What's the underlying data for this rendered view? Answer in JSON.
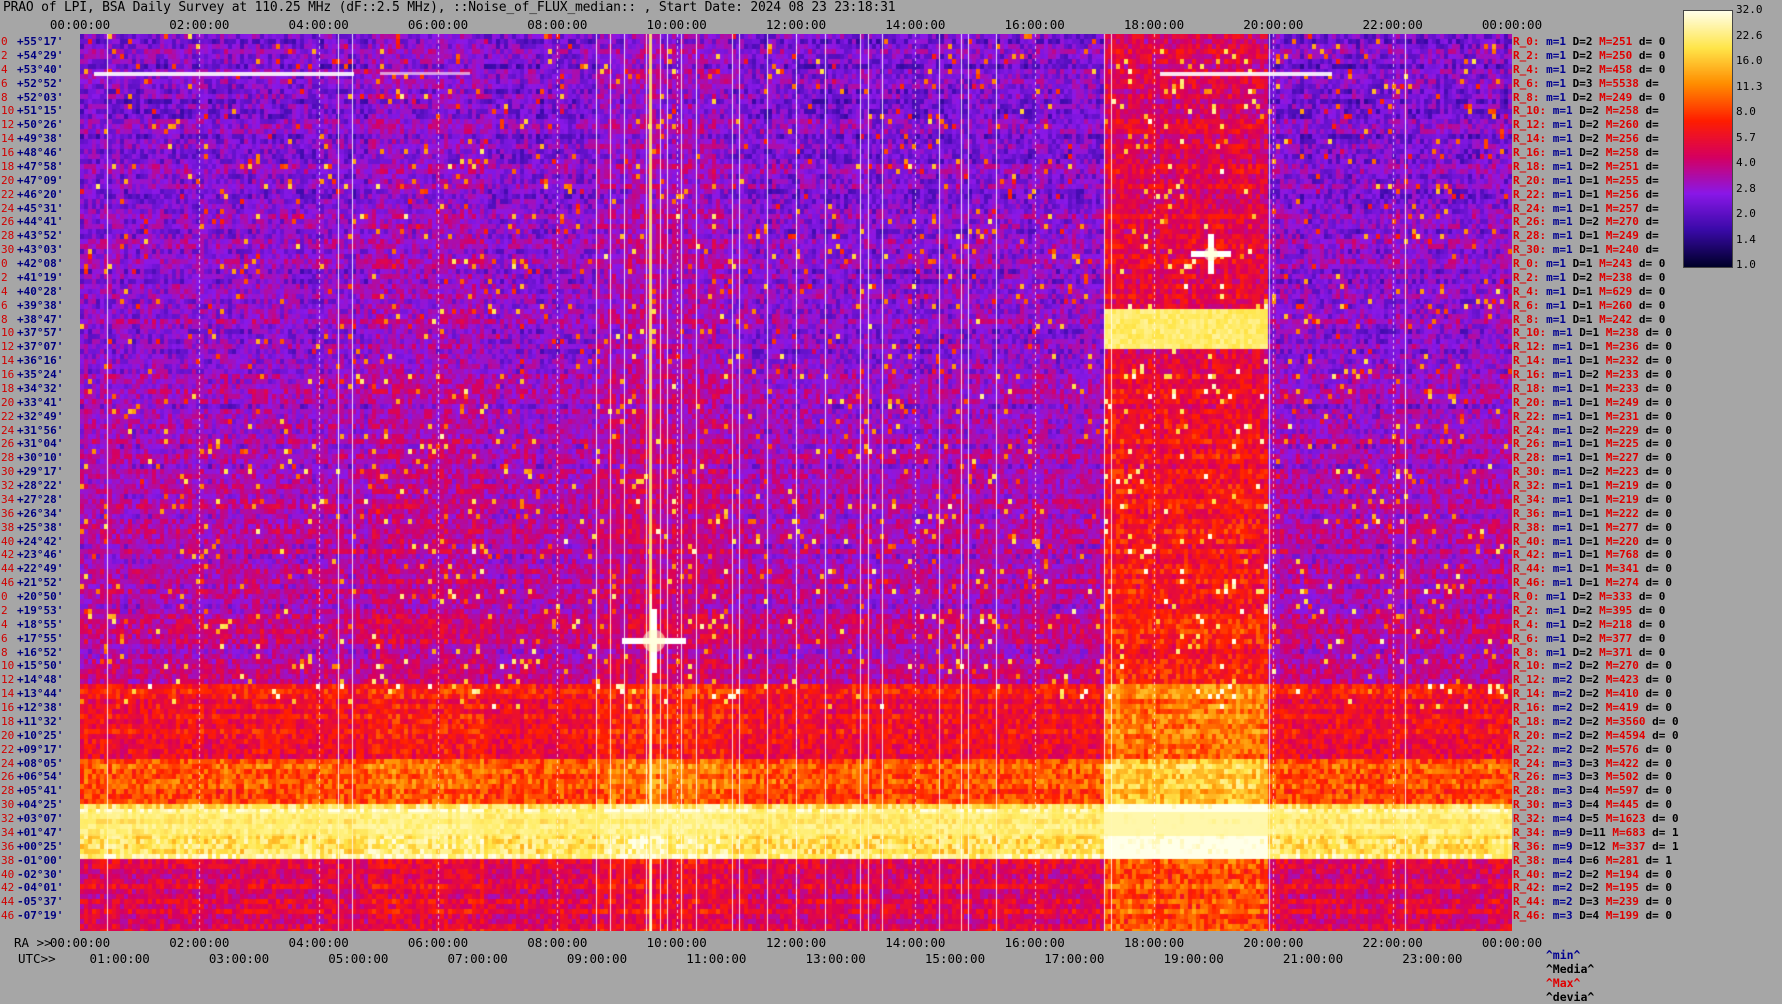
{
  "title": "PRAO of LPI, BSA Daily Survey at 110.25 MHz (dF::2.5 MHz), ::Noise_of_FLUX_median:: , Start Date: 2024 08 23 23:18:31",
  "top_ticks": [
    "00:00:00",
    "02:00:00",
    "04:00:00",
    "06:00:00",
    "08:00:00",
    "10:00:00",
    "12:00:00",
    "14:00:00",
    "16:00:00",
    "18:00:00",
    "20:00:00",
    "22:00:00",
    "00:00:00"
  ],
  "ra_prefix": "RA >>",
  "ra_ticks": [
    "00:00:00",
    "02:00:00",
    "04:00:00",
    "06:00:00",
    "08:00:00",
    "10:00:00",
    "12:00:00",
    "14:00:00",
    "16:00:00",
    "18:00:00",
    "20:00:00",
    "22:00:00",
    "00:00:00"
  ],
  "utc_prefix": "UTC>>",
  "utc_ticks": [
    "01:00:00",
    "03:00:00",
    "05:00:00",
    "07:00:00",
    "09:00:00",
    "11:00:00",
    "13:00:00",
    "15:00:00",
    "17:00:00",
    "19:00:00",
    "21:00:00",
    "23:00:00"
  ],
  "left_labels": [
    {
      "idx": "0",
      "dec": "+55°17'"
    },
    {
      "idx": "2",
      "dec": "+54°29'"
    },
    {
      "idx": "4",
      "dec": "+53°40'"
    },
    {
      "idx": "6",
      "dec": "+52°52'"
    },
    {
      "idx": "8",
      "dec": "+52°03'"
    },
    {
      "idx": "10",
      "dec": "+51°15'"
    },
    {
      "idx": "12",
      "dec": "+50°26'"
    },
    {
      "idx": "14",
      "dec": "+49°38'"
    },
    {
      "idx": "16",
      "dec": "+48°46'"
    },
    {
      "idx": "18",
      "dec": "+47°58'"
    },
    {
      "idx": "20",
      "dec": "+47°09'"
    },
    {
      "idx": "22",
      "dec": "+46°20'"
    },
    {
      "idx": "24",
      "dec": "+45°31'"
    },
    {
      "idx": "26",
      "dec": "+44°41'"
    },
    {
      "idx": "28",
      "dec": "+43°52'"
    },
    {
      "idx": "30",
      "dec": "+43°03'"
    },
    {
      "idx": "0",
      "dec": "+42°08'"
    },
    {
      "idx": "2",
      "dec": "+41°19'"
    },
    {
      "idx": "4",
      "dec": "+40°28'"
    },
    {
      "idx": "6",
      "dec": "+39°38'"
    },
    {
      "idx": "8",
      "dec": "+38°47'"
    },
    {
      "idx": "10",
      "dec": "+37°57'"
    },
    {
      "idx": "12",
      "dec": "+37°07'"
    },
    {
      "idx": "14",
      "dec": "+36°16'"
    },
    {
      "idx": "16",
      "dec": "+35°24'"
    },
    {
      "idx": "18",
      "dec": "+34°32'"
    },
    {
      "idx": "20",
      "dec": "+33°41'"
    },
    {
      "idx": "22",
      "dec": "+32°49'"
    },
    {
      "idx": "24",
      "dec": "+31°56'"
    },
    {
      "idx": "26",
      "dec": "+31°04'"
    },
    {
      "idx": "28",
      "dec": "+30°10'"
    },
    {
      "idx": "30",
      "dec": "+29°17'"
    },
    {
      "idx": "32",
      "dec": "+28°22'"
    },
    {
      "idx": "34",
      "dec": "+27°28'"
    },
    {
      "idx": "36",
      "dec": "+26°34'"
    },
    {
      "idx": "38",
      "dec": "+25°38'"
    },
    {
      "idx": "40",
      "dec": "+24°42'"
    },
    {
      "idx": "42",
      "dec": "+23°46'"
    },
    {
      "idx": "44",
      "dec": "+22°49'"
    },
    {
      "idx": "46",
      "dec": "+21°52'"
    },
    {
      "idx": "0",
      "dec": "+20°50'"
    },
    {
      "idx": "2",
      "dec": "+19°53'"
    },
    {
      "idx": "4",
      "dec": "+18°55'"
    },
    {
      "idx": "6",
      "dec": "+17°55'"
    },
    {
      "idx": "8",
      "dec": "+16°52'"
    },
    {
      "idx": "10",
      "dec": "+15°50'"
    },
    {
      "idx": "12",
      "dec": "+14°48'"
    },
    {
      "idx": "14",
      "dec": "+13°44'"
    },
    {
      "idx": "16",
      "dec": "+12°38'"
    },
    {
      "idx": "18",
      "dec": "+11°32'"
    },
    {
      "idx": "20",
      "dec": "+10°25'"
    },
    {
      "idx": "22",
      "dec": "+09°17'"
    },
    {
      "idx": "24",
      "dec": "+08°05'"
    },
    {
      "idx": "26",
      "dec": "+06°54'"
    },
    {
      "idx": "28",
      "dec": "+05°41'"
    },
    {
      "idx": "30",
      "dec": "+04°25'"
    },
    {
      "idx": "32",
      "dec": "+03°07'"
    },
    {
      "idx": "34",
      "dec": "+01°47'"
    },
    {
      "idx": "36",
      "dec": "+00°25'"
    },
    {
      "idx": "38",
      "dec": "-01°00'"
    },
    {
      "idx": "40",
      "dec": "-02°30'"
    },
    {
      "idx": "42",
      "dec": "-04°01'"
    },
    {
      "idx": "44",
      "dec": "-05°37'"
    },
    {
      "idx": "46",
      "dec": "-07°19'"
    }
  ],
  "right_labels": [
    {
      "name": "R_0:",
      "m": "m=1",
      "d": "D=2",
      "M": "M=251",
      "dev": "d= 0"
    },
    {
      "name": "R_2:",
      "m": "m=1",
      "d": "D=2",
      "M": "M=250",
      "dev": "d= 0"
    },
    {
      "name": "R_4:",
      "m": "m=1",
      "d": "D=2",
      "M": "M=458",
      "dev": "d= 0"
    },
    {
      "name": "R_6:",
      "m": "m=1",
      "d": "D=3",
      "M": "M=5538",
      "dev": "d="
    },
    {
      "name": "R_8:",
      "m": "m=1",
      "d": "D=2",
      "M": "M=249",
      "dev": "d= 0"
    },
    {
      "name": "R_10:",
      "m": "m=1",
      "d": "D=2",
      "M": "M=258",
      "dev": "d="
    },
    {
      "name": "R_12:",
      "m": "m=1",
      "d": "D=2",
      "M": "M=260",
      "dev": "d="
    },
    {
      "name": "R_14:",
      "m": "m=1",
      "d": "D=2",
      "M": "M=256",
      "dev": "d="
    },
    {
      "name": "R_16:",
      "m": "m=1",
      "d": "D=2",
      "M": "M=258",
      "dev": "d="
    },
    {
      "name": "R_18:",
      "m": "m=1",
      "d": "D=2",
      "M": "M=251",
      "dev": "d="
    },
    {
      "name": "R_20:",
      "m": "m=1",
      "d": "D=1",
      "M": "M=255",
      "dev": "d="
    },
    {
      "name": "R_22:",
      "m": "m=1",
      "d": "D=1",
      "M": "M=256",
      "dev": "d="
    },
    {
      "name": "R_24:",
      "m": "m=1",
      "d": "D=1",
      "M": "M=257",
      "dev": "d="
    },
    {
      "name": "R_26:",
      "m": "m=1",
      "d": "D=2",
      "M": "M=270",
      "dev": "d="
    },
    {
      "name": "R_28:",
      "m": "m=1",
      "d": "D=1",
      "M": "M=249",
      "dev": "d="
    },
    {
      "name": "R_30:",
      "m": "m=1",
      "d": "D=1",
      "M": "M=240",
      "dev": "d="
    },
    {
      "name": "R_0:",
      "m": "m=1",
      "d": "D=1",
      "M": "M=243",
      "dev": "d= 0"
    },
    {
      "name": "R_2:",
      "m": "m=1",
      "d": "D=2",
      "M": "M=238",
      "dev": "d= 0"
    },
    {
      "name": "R_4:",
      "m": "m=1",
      "d": "D=1",
      "M": "M=629",
      "dev": "d= 0"
    },
    {
      "name": "R_6:",
      "m": "m=1",
      "d": "D=1",
      "M": "M=260",
      "dev": "d= 0"
    },
    {
      "name": "R_8:",
      "m": "m=1",
      "d": "D=1",
      "M": "M=242",
      "dev": "d= 0"
    },
    {
      "name": "R_10:",
      "m": "m=1",
      "d": "D=1",
      "M": "M=238",
      "dev": "d= 0"
    },
    {
      "name": "R_12:",
      "m": "m=1",
      "d": "D=1",
      "M": "M=236",
      "dev": "d= 0"
    },
    {
      "name": "R_14:",
      "m": "m=1",
      "d": "D=1",
      "M": "M=232",
      "dev": "d= 0"
    },
    {
      "name": "R_16:",
      "m": "m=1",
      "d": "D=2",
      "M": "M=233",
      "dev": "d= 0"
    },
    {
      "name": "R_18:",
      "m": "m=1",
      "d": "D=1",
      "M": "M=233",
      "dev": "d= 0"
    },
    {
      "name": "R_20:",
      "m": "m=1",
      "d": "D=1",
      "M": "M=249",
      "dev": "d= 0"
    },
    {
      "name": "R_22:",
      "m": "m=1",
      "d": "D=1",
      "M": "M=231",
      "dev": "d= 0"
    },
    {
      "name": "R_24:",
      "m": "m=1",
      "d": "D=2",
      "M": "M=229",
      "dev": "d= 0"
    },
    {
      "name": "R_26:",
      "m": "m=1",
      "d": "D=1",
      "M": "M=225",
      "dev": "d= 0"
    },
    {
      "name": "R_28:",
      "m": "m=1",
      "d": "D=1",
      "M": "M=227",
      "dev": "d= 0"
    },
    {
      "name": "R_30:",
      "m": "m=1",
      "d": "D=2",
      "M": "M=223",
      "dev": "d= 0"
    },
    {
      "name": "R_32:",
      "m": "m=1",
      "d": "D=1",
      "M": "M=219",
      "dev": "d= 0"
    },
    {
      "name": "R_34:",
      "m": "m=1",
      "d": "D=1",
      "M": "M=219",
      "dev": "d= 0"
    },
    {
      "name": "R_36:",
      "m": "m=1",
      "d": "D=1",
      "M": "M=222",
      "dev": "d= 0"
    },
    {
      "name": "R_38:",
      "m": "m=1",
      "d": "D=1",
      "M": "M=277",
      "dev": "d= 0"
    },
    {
      "name": "R_40:",
      "m": "m=1",
      "d": "D=1",
      "M": "M=220",
      "dev": "d= 0"
    },
    {
      "name": "R_42:",
      "m": "m=1",
      "d": "D=1",
      "M": "M=768",
      "dev": "d= 0"
    },
    {
      "name": "R_44:",
      "m": "m=1",
      "d": "D=1",
      "M": "M=341",
      "dev": "d= 0"
    },
    {
      "name": "R_46:",
      "m": "m=1",
      "d": "D=1",
      "M": "M=274",
      "dev": "d= 0"
    },
    {
      "name": "R_0:",
      "m": "m=1",
      "d": "D=2",
      "M": "M=333",
      "dev": "d= 0"
    },
    {
      "name": "R_2:",
      "m": "m=1",
      "d": "D=2",
      "M": "M=395",
      "dev": "d= 0"
    },
    {
      "name": "R_4:",
      "m": "m=1",
      "d": "D=2",
      "M": "M=218",
      "dev": "d= 0"
    },
    {
      "name": "R_6:",
      "m": "m=1",
      "d": "D=2",
      "M": "M=377",
      "dev": "d= 0"
    },
    {
      "name": "R_8:",
      "m": "m=1",
      "d": "D=2",
      "M": "M=371",
      "dev": "d= 0"
    },
    {
      "name": "R_10:",
      "m": "m=2",
      "d": "D=2",
      "M": "M=270",
      "dev": "d= 0"
    },
    {
      "name": "R_12:",
      "m": "m=2",
      "d": "D=2",
      "M": "M=423",
      "dev": "d= 0"
    },
    {
      "name": "R_14:",
      "m": "m=2",
      "d": "D=2",
      "M": "M=410",
      "dev": "d= 0"
    },
    {
      "name": "R_16:",
      "m": "m=2",
      "d": "D=2",
      "M": "M=419",
      "dev": "d= 0"
    },
    {
      "name": "R_18:",
      "m": "m=2",
      "d": "D=2",
      "M": "M=3560",
      "dev": "d= 0"
    },
    {
      "name": "R_20:",
      "m": "m=2",
      "d": "D=2",
      "M": "M=4594",
      "dev": "d= 0"
    },
    {
      "name": "R_22:",
      "m": "m=2",
      "d": "D=2",
      "M": "M=576",
      "dev": "d= 0"
    },
    {
      "name": "R_24:",
      "m": "m=3",
      "d": "D=3",
      "M": "M=422",
      "dev": "d= 0"
    },
    {
      "name": "R_26:",
      "m": "m=3",
      "d": "D=3",
      "M": "M=502",
      "dev": "d= 0"
    },
    {
      "name": "R_28:",
      "m": "m=3",
      "d": "D=4",
      "M": "M=597",
      "dev": "d= 0"
    },
    {
      "name": "R_30:",
      "m": "m=3",
      "d": "D=4",
      "M": "M=445",
      "dev": "d= 0"
    },
    {
      "name": "R_32:",
      "m": "m=4",
      "d": "D=5",
      "M": "M=1623",
      "dev": "d= 0"
    },
    {
      "name": "R_34:",
      "m": "m=9",
      "d": "D=11",
      "M": "M=683",
      "dev": "d= 1"
    },
    {
      "name": "R_36:",
      "m": "m=9",
      "d": "D=12",
      "M": "M=337",
      "dev": "d= 1"
    },
    {
      "name": "R_38:",
      "m": "m=4",
      "d": "D=6",
      "M": "M=281",
      "dev": "d= 1"
    },
    {
      "name": "R_40:",
      "m": "m=2",
      "d": "D=2",
      "M": "M=194",
      "dev": "d= 0"
    },
    {
      "name": "R_42:",
      "m": "m=2",
      "d": "D=2",
      "M": "M=195",
      "dev": "d= 0"
    },
    {
      "name": "R_44:",
      "m": "m=2",
      "d": "D=3",
      "M": "M=239",
      "dev": "d= 0"
    },
    {
      "name": "R_46:",
      "m": "m=3",
      "d": "D=4",
      "M": "M=199",
      "dev": "d= 0"
    }
  ],
  "legend": {
    "min": "^min^",
    "median": "^Media^",
    "max": "^Max^",
    "dev": "^devia^"
  },
  "colorbar": {
    "ticks": [
      "32.0",
      "22.6",
      "16.0",
      "11.3",
      "8.0",
      "5.7",
      "4.0",
      "2.8",
      "2.0",
      "1.4",
      "1.0"
    ]
  },
  "colors": {
    "background": "#a6a6a6",
    "name_red": "#e00000",
    "m_blue": "#000090"
  },
  "chart_data": {
    "type": "heatmap",
    "title": "PRAO of LPI, BSA Daily Survey at 110.25 MHz (dF::2.5 MHz), ::Noise_of_FLUX_median:: , Start Date: 2024 08 23 23:18:31",
    "x_axis": "RA (hh:mm:ss), 00:00:00 to 24:00:00",
    "y_axis": "Declination, +55°17' to -07°19'",
    "colorbar_range": [
      1.0,
      32.0
    ],
    "colorbar_scale": "log",
    "colormap": [
      "#00002a",
      "#3a0aa8",
      "#8a18e8",
      "#d60060",
      "#ff1e00",
      "#ff8c00",
      "#ffe64a",
      "#ffffe8"
    ],
    "bright_horizontal_band_dec": [
      "+01°47'",
      "+00°25'"
    ],
    "bright_source": {
      "ra": "10:15",
      "dec": "+11°32'"
    },
    "bright_source_2": {
      "ra": "20:00",
      "dec": "+40°28'"
    },
    "rfi_block_ra": [
      "18:30",
      "21:10"
    ]
  }
}
